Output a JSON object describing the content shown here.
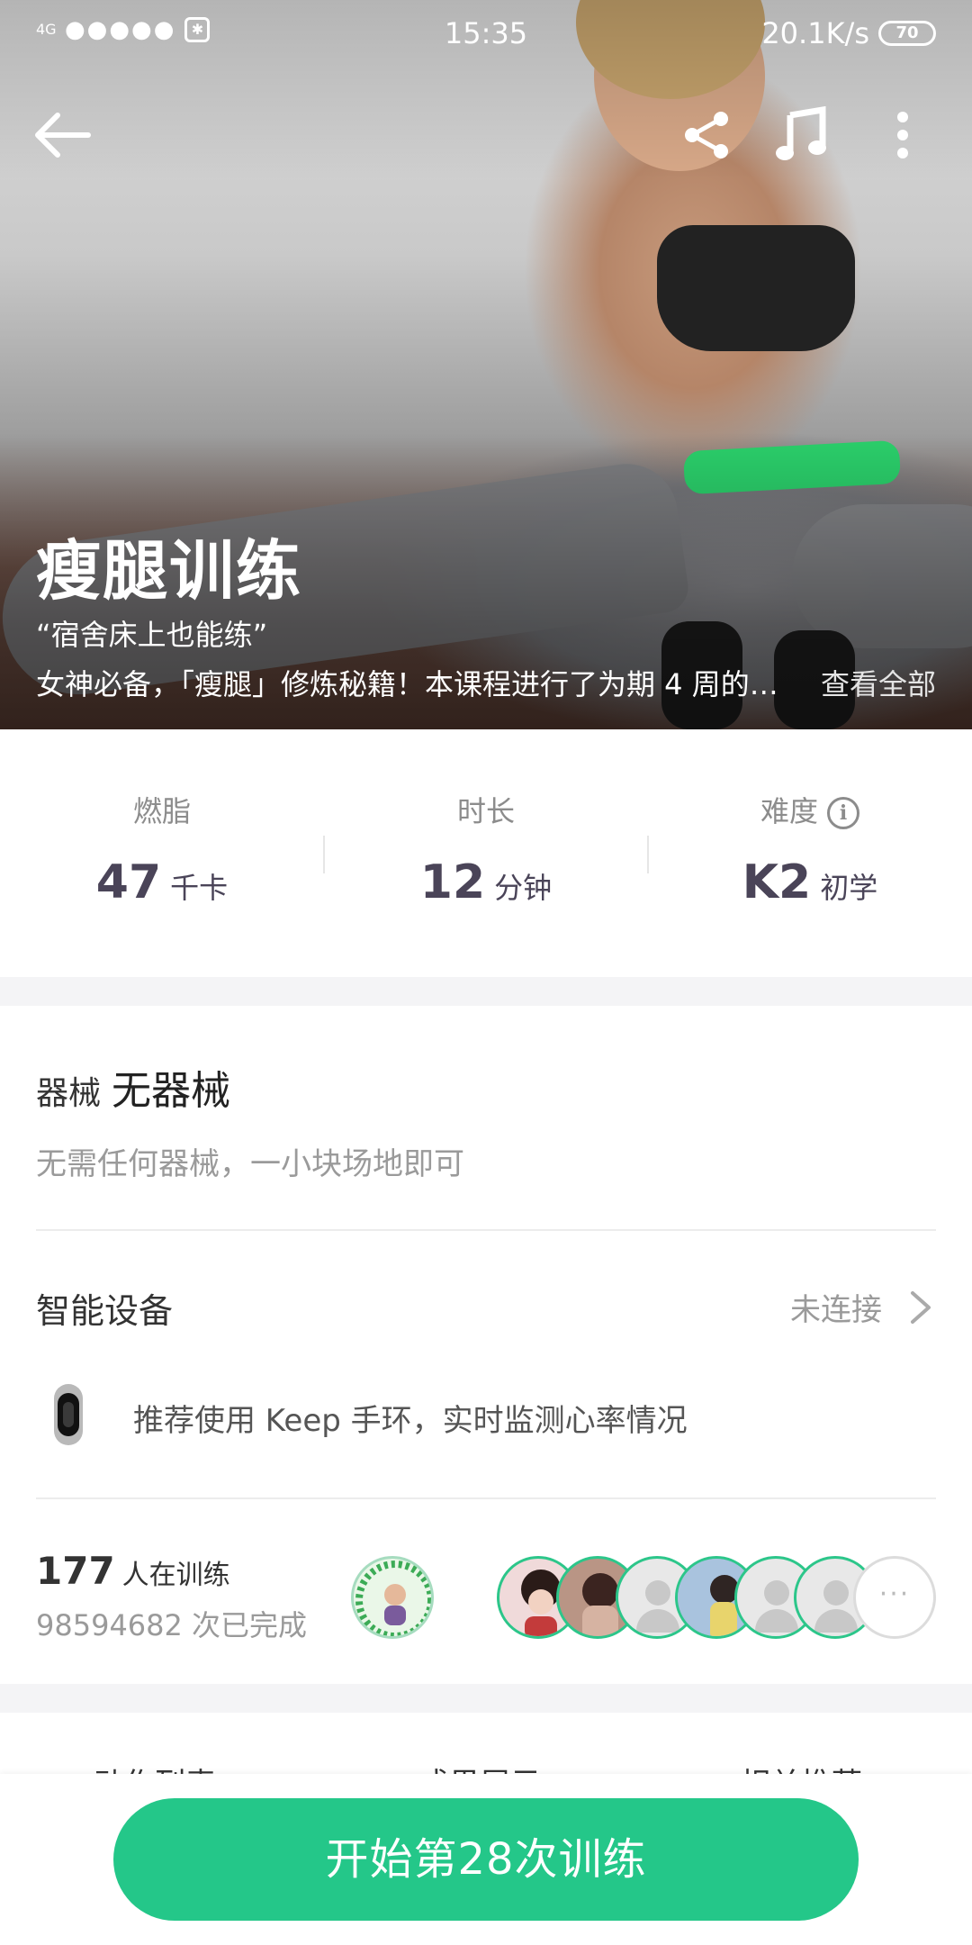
{
  "status_bar": {
    "network": "4G",
    "signal": "●●●●●",
    "time": "15:35",
    "speed": "20.1K/s",
    "battery": "70"
  },
  "hero": {
    "title": "瘦腿训练",
    "quote": "“宿舍床上也能练”",
    "description": "女神必备，「瘦腿」修炼秘籍！本课程进行了为期 4 周的…",
    "more_link": "查看全部"
  },
  "stats": [
    {
      "label": "燃脂",
      "value": "47",
      "unit": "千卡"
    },
    {
      "label": "时长",
      "value": "12",
      "unit": "分钟"
    },
    {
      "label": "难度",
      "value": "K2",
      "unit": "初学"
    }
  ],
  "equipment": {
    "label": "器械",
    "name": "无器械",
    "description": "无需任何器械，一小块场地即可"
  },
  "smart_device": {
    "title": "智能设备",
    "status": "未连接",
    "recommendation": "推荐使用 Keep 手环，实时监测心率情况"
  },
  "training": {
    "count": "177",
    "count_label": "人在训练",
    "completed": "98594682 次已完成",
    "more_dots": "···"
  },
  "tabs": [
    "动作列表",
    "成果展示",
    "相关推荐"
  ],
  "start_button": "开始第28次训练",
  "colors": {
    "accent": "#24c789",
    "stat_value": "#4a4458",
    "muted": "#9a9a9a"
  }
}
